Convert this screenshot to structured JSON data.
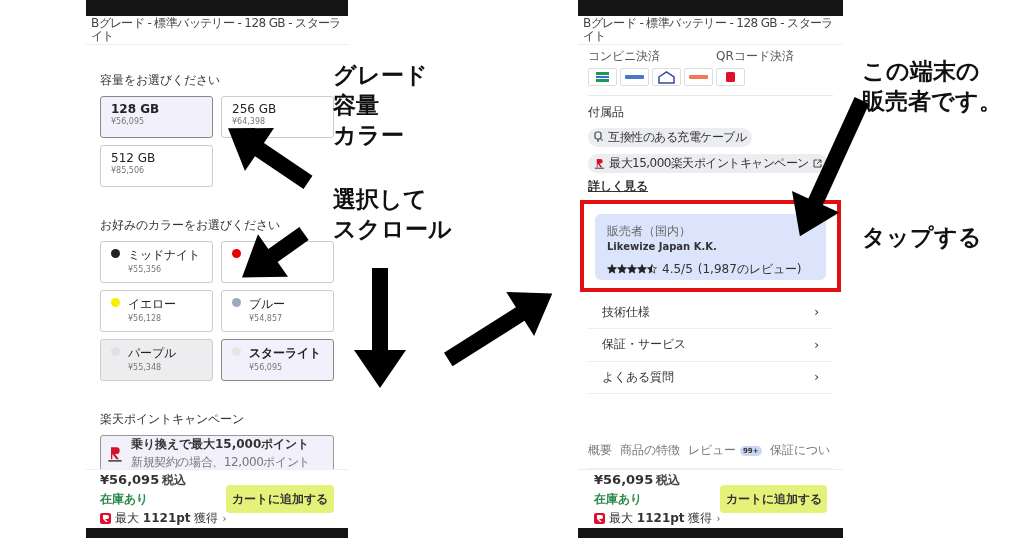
{
  "left_screen": {
    "header": "Bグレード - 標準バッテリー - 128 GB - スターライト",
    "capacity": {
      "title": "容量をお選びください",
      "options": [
        {
          "label": "128 GB",
          "price": "¥56,095",
          "selected": true
        },
        {
          "label": "256 GB",
          "price": "¥64,398",
          "selected": false
        },
        {
          "label": "512 GB",
          "price": "¥85,506",
          "selected": false
        }
      ]
    },
    "color": {
      "title": "お好みのカラーをお選びください",
      "options": [
        {
          "name": "ミッドナイト",
          "price": "¥55,356",
          "color": "#222222",
          "selected": false,
          "disabled": false
        },
        {
          "color": "#e60000",
          "selected": false,
          "disabled": false
        },
        {
          "name": "イエロー",
          "price": "¥56,128",
          "color": "#f5f000",
          "selected": false,
          "disabled": false
        },
        {
          "name": "ブルー",
          "price": "¥54,857",
          "color": "#9aa8c0",
          "selected": false,
          "disabled": false
        },
        {
          "name": "パープル",
          "price": "¥55,348",
          "color": "#e4dfe6",
          "selected": false,
          "disabled": true
        },
        {
          "name": "スターライト",
          "price": "¥56,095",
          "color": "#e6e6e3",
          "selected": true,
          "disabled": false
        }
      ]
    },
    "campaign": {
      "title": "楽天ポイントキャンペーン",
      "headline": "乗り換えで最大15,000ポイント",
      "note": "新規契約の場合、12,000ポイント"
    },
    "footer": {
      "price": "¥56,095",
      "tax": "税込",
      "stock": "在庫あり",
      "points": "最大 **1121pt** 獲得",
      "chevron": "›",
      "button": "カートに追加する"
    }
  },
  "right_screen": {
    "header": "Bグレード - 標準バッテリー - 128 GB - スターライト",
    "payments": [
      {
        "title": "コンビニ決済",
        "icons": [
          {
            "kind": "bars"
          },
          {
            "kind": "blue"
          },
          {
            "kind": "house"
          },
          {
            "kind": "orange"
          }
        ]
      },
      {
        "title": "QRコード決済",
        "icons": [
          {
            "kind": "red"
          }
        ]
      }
    ],
    "accessories": {
      "title": "付属品",
      "chips": [
        {
          "kind": "cable",
          "label": "互換性のある充電ケーブル"
        },
        {
          "kind": "points",
          "label": "最大15,000楽天ポイントキャンペーン"
        }
      ]
    },
    "more_link": "詳しく見る",
    "seller": {
      "caption": "販売者（国内）",
      "name": "Likewize Japan K.K.",
      "stars": 4.5,
      "rating": "4.5/5",
      "reviews": "(1,987のレビュー)"
    },
    "links": [
      {
        "label": "技術仕様",
        "chevron": "›"
      },
      {
        "label": "保証・サービス",
        "chevron": "›"
      },
      {
        "label": "よくある質問",
        "chevron": "›"
      }
    ],
    "tabs": [
      {
        "label": "概要",
        "selected": false
      },
      {
        "label": "商品の特徴",
        "selected": false
      },
      {
        "label": "レビュー",
        "badge": "99+",
        "selected": false
      },
      {
        "label": "保証につい",
        "selected": false
      }
    ],
    "footer": {
      "price": "¥56,095",
      "tax": "税込",
      "stock": "在庫あり",
      "points": "最大 **1121pt** 獲得",
      "chevron": "›",
      "button": "カートに追加する"
    }
  },
  "annotations": [
    {
      "lines": [
        "グレード",
        "容量",
        "カラー"
      ]
    },
    {
      "lines": [
        "選択して",
        "スクロール"
      ]
    },
    {
      "lines": [
        "この端末の",
        "販売者です。"
      ]
    },
    {
      "lines": [
        "タップする"
      ]
    }
  ]
}
